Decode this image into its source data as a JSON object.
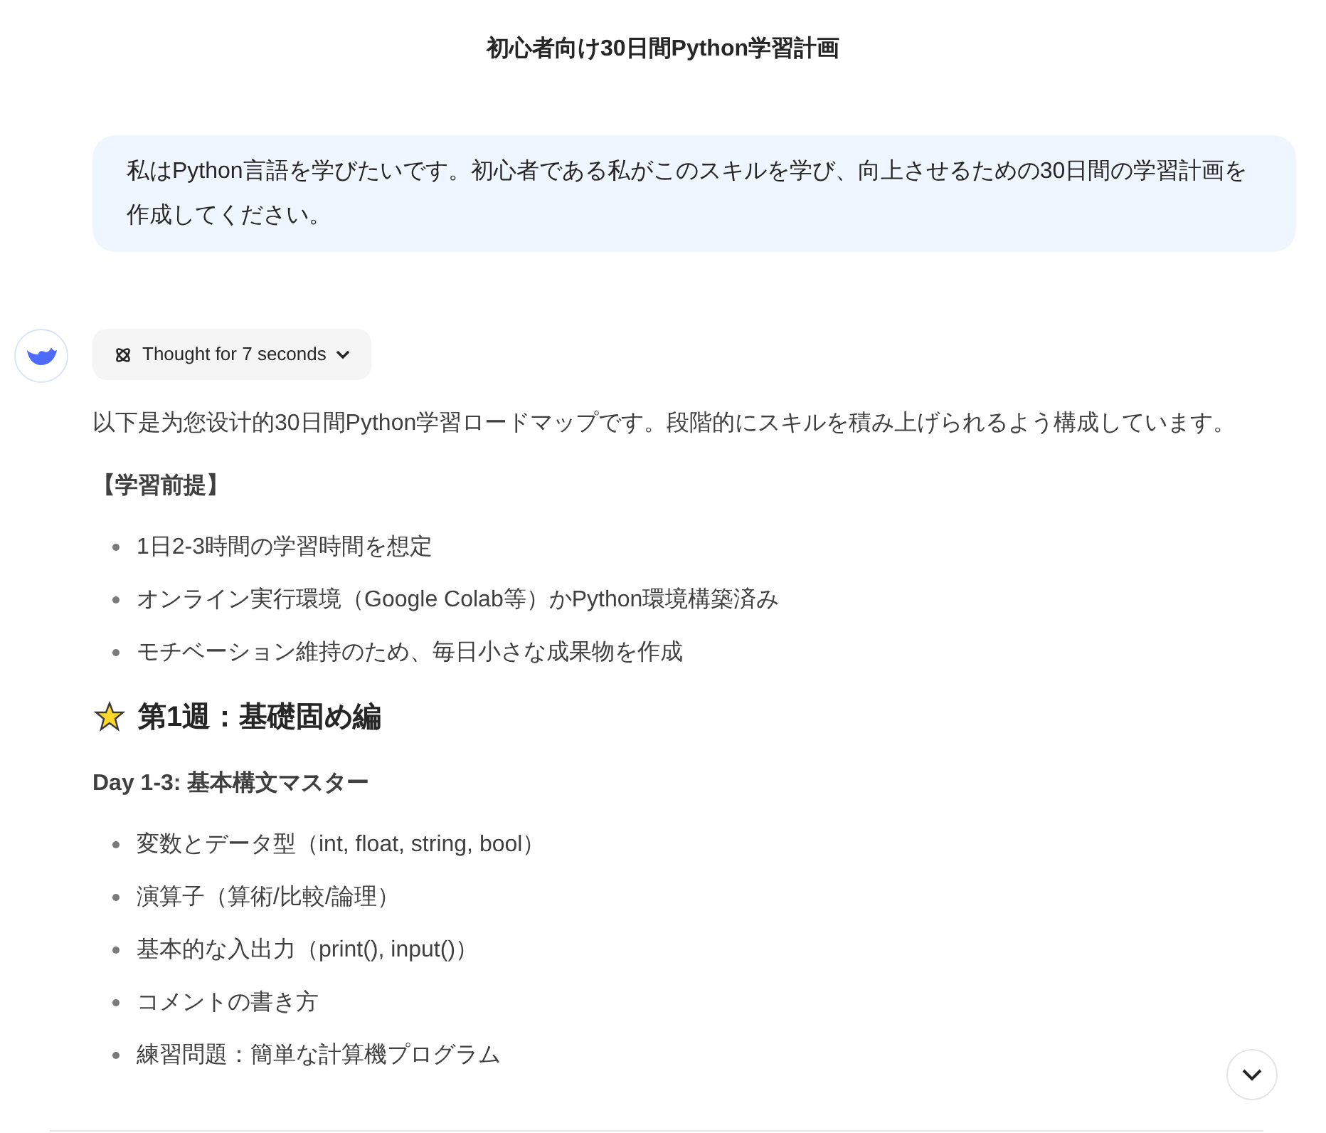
{
  "title": "初心者向け30日間Python学習計画",
  "user_message": "私はPython言語を学びたいです。初心者である私がこのスキルを学び、向上させるための30日間の学習計画を作成してください。",
  "thought": {
    "label": "Thought for 7 seconds",
    "expanded": false
  },
  "intro": "以下是为您设计的30日間Python学習ロードマップです。段階的にスキルを積み上げられるよう構成しています。",
  "prereq_heading": "【学習前提】",
  "prereq_items": [
    "1日2-3時間の学習時間を想定",
    "オンライン実行環境（Google Colab等）かPython環境構築済み",
    "モチベーション維持のため、毎日小さな成果物を作成"
  ],
  "week_heading": "第1週：基礎固め編",
  "day_heading": "Day 1-3: 基本構文マスター",
  "day_items": [
    "変数とデータ型（int, float, string, bool）",
    "演算子（算術/比較/論理）",
    "基本的な入出力（print(), input()）",
    "コメントの書き方",
    "練習問題：簡単な計算機プログラム"
  ]
}
